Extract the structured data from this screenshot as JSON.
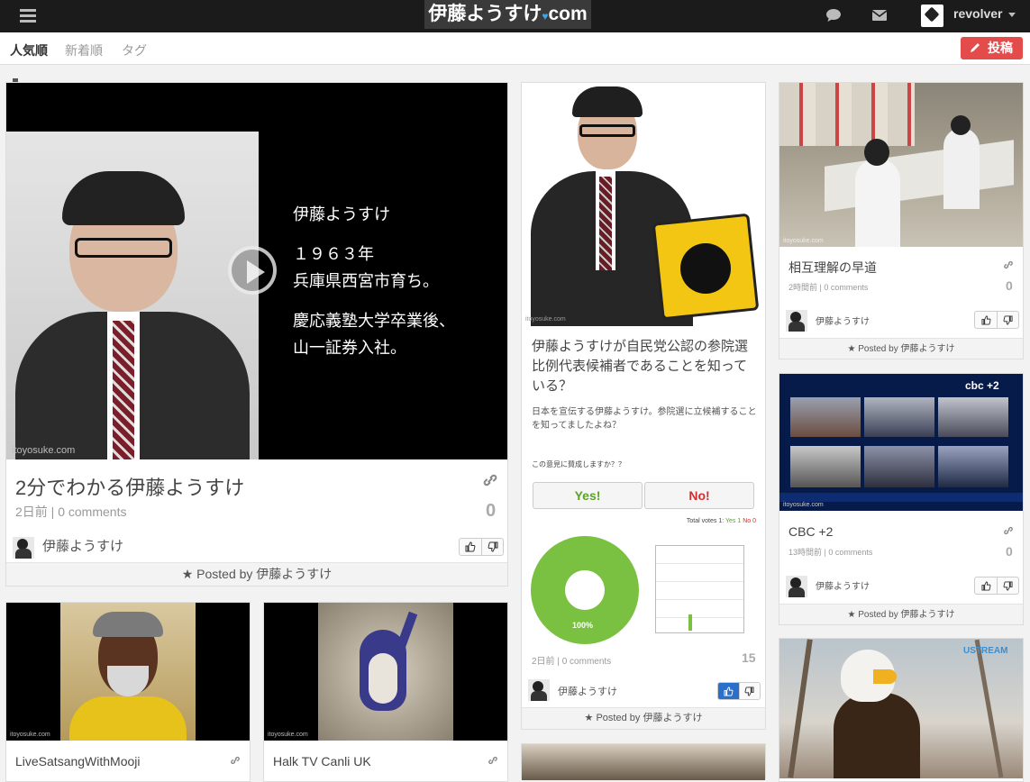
{
  "header": {
    "logo_text": "伊藤ようすけ",
    "logo_heart": "♥",
    "logo_tld": "com",
    "username": "revolver"
  },
  "subnav": {
    "tabs": [
      "人気順",
      "新着順",
      "タグ"
    ],
    "post_button": "投稿"
  },
  "posts": [
    {
      "title": "2分でわかる伊藤ようすけ",
      "time": "2日前",
      "comments": "0 comments",
      "count": "0",
      "author": "伊藤ようすけ",
      "footer": "Posted by 伊藤ようすけ",
      "overlay": {
        "name": "伊藤ようすけ",
        "line1": "１９６３年",
        "line2": "兵庫県西宮市育ち。",
        "line3": "慶応義塾大学卒業後、",
        "line4": "山一証券入社。",
        "watermark": "itoyosuke.com"
      }
    },
    {
      "title": "伊藤ようすけが自民党公認の参院選比例代表候補者であることを知っている？",
      "desc": "日本を宣伝する伊藤ようすけ。参院選に立候補することを知ってましたよね？",
      "question": "この意見に賛成しますか？？",
      "yes": "Yes!",
      "no": "No!",
      "totals": {
        "label": "Total votes 1:",
        "yes": "Yes 1",
        "no": "No 0"
      },
      "pie_pct": "100%",
      "time": "2日前",
      "comments": "0 comments",
      "count": "15",
      "author": "伊藤ようすけ",
      "footer": "Posted by 伊藤ようすけ",
      "watermark": "itoyosuke.com"
    },
    {
      "title": "相互理解の早道",
      "time": "2時間前",
      "comments": "0 comments",
      "count": "0",
      "author": "伊藤ようすけ",
      "footer": "Posted by 伊藤ようすけ",
      "watermark": "itoyosuke.com"
    },
    {
      "title": "CBC +2",
      "time": "13時間前",
      "comments": "0 comments",
      "count": "0",
      "author": "伊藤ようすけ",
      "footer": "Posted by 伊藤ようすけ",
      "watermark": "itoyosuke.com",
      "channel": "cbc +2"
    },
    {
      "title": "LiveSatsangWithMooji",
      "watermark": "itoyosuke.com"
    },
    {
      "title": "Halk TV Canli UK",
      "watermark": "itoyosuke.com"
    },
    {
      "title": "",
      "watermark": "USTREAM"
    }
  ],
  "colors": {
    "accent_red": "#e44c4c",
    "poll_green": "#7ac142",
    "yes_green": "#5aa526",
    "no_red": "#d03030",
    "vote_blue": "#2a6fc9"
  }
}
